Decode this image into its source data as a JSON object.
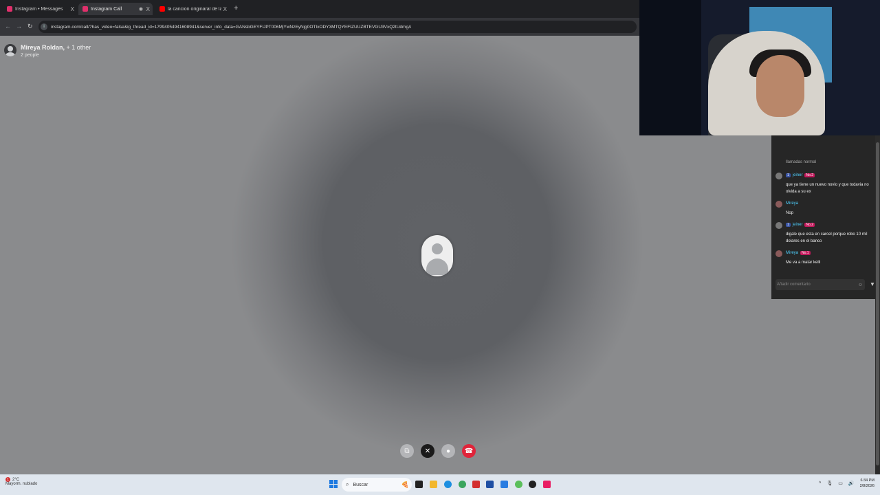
{
  "browser": {
    "tabs": [
      {
        "label": "Instagram • Messages",
        "active": false,
        "color": "#e1306c"
      },
      {
        "label": "Instagram Call",
        "active": true,
        "color": "#e1306c"
      },
      {
        "label": "la cancion originaral de la par",
        "active": false,
        "color": "#ff0000"
      }
    ],
    "tab_close": "X",
    "new_tab": "+",
    "url": "instagram.com/call/?has_video=false&ig_thread_id=17994054941608941&server_info_data=GANsbGEYFIJPT006MjYwNzEyNjg0OTIxODY3MTQYEFIZUUZBTEVGU3VxQ2tUdmgA"
  },
  "call": {
    "participants_title": "Mireya Roldan,",
    "participants_more": "+ 1 other",
    "people_count": "2 people",
    "accent_end_call": "#e0243a"
  },
  "chat": {
    "top_cut_text": "llamadas normal",
    "messages": [
      {
        "user": "jeiner",
        "badge1": "1",
        "badge2": "No.2",
        "text": "que ya tiene un nuevo novio y que todavia no olvida a su ex"
      },
      {
        "user": "Mireya",
        "badge1": "",
        "badge2": "",
        "text": "Nop"
      },
      {
        "user": "jeiner",
        "badge1": "1",
        "badge2": "No.2",
        "text": "digale que esta en carcel porque robo 10 mil dolares en el banco"
      },
      {
        "user": "Mireya",
        "badge1": "",
        "badge2": "No.1",
        "text": "Me va a matar kelli"
      }
    ],
    "comment_placeholder": "Añadir comentario"
  },
  "taskbar": {
    "weather_temp": "2°C",
    "weather_desc": "Mayorm. nublado",
    "weather_alert": "1",
    "search_label": "Buscar",
    "time": "6:34 PM",
    "date": "2/8/2026"
  }
}
